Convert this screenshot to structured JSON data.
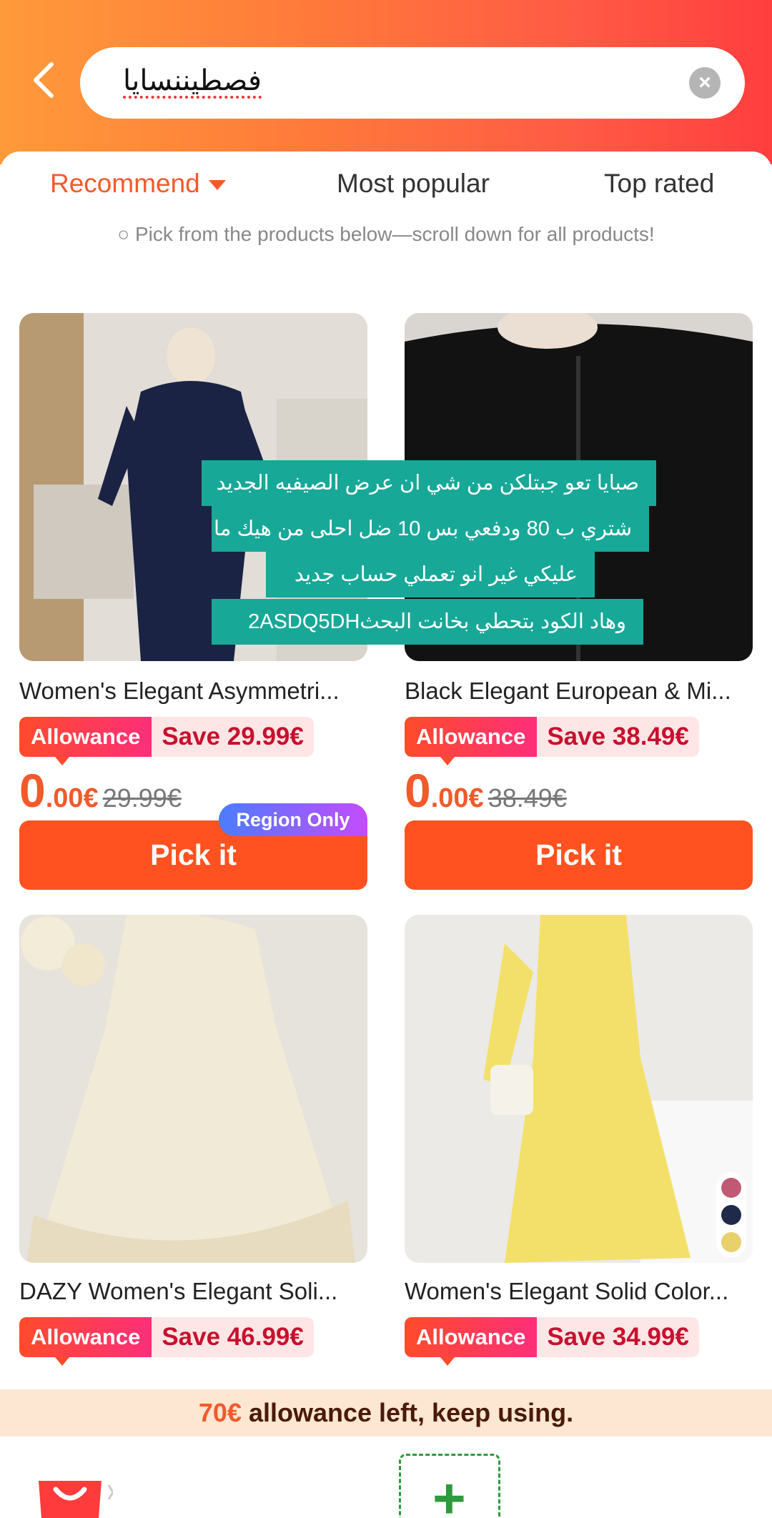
{
  "search": {
    "query": "فصطيننسايا"
  },
  "tabs": [
    {
      "label": "Recommend"
    },
    {
      "label": "Most popular"
    },
    {
      "label": "Top rated"
    }
  ],
  "hint": "○ Pick from the products below—scroll down for all products!",
  "products": [
    {
      "title": "Women's Elegant Asymmetri...",
      "allowance": "Allowance",
      "save": "Save 29.99€",
      "price_int": "0",
      "price_dec": ".00€",
      "old_price": "29.99€",
      "button": "Pick it",
      "tag": "Region Only"
    },
    {
      "title": "Black Elegant European & Mi...",
      "allowance": "Allowance",
      "save": "Save 38.49€",
      "price_int": "0",
      "price_dec": ".00€",
      "old_price": "38.49€",
      "button": "Pick it"
    },
    {
      "title": "DAZY Women's Elegant Soli...",
      "allowance": "Allowance",
      "save": "Save 46.99€"
    },
    {
      "title": "Women's Elegant Solid Color...",
      "allowance": "Allowance",
      "save": "Save 34.99€"
    }
  ],
  "overlay": {
    "lines": [
      "صبايا تعو جبتلكن من شي ان عرض الصيفيه الجديد",
      "شتري ب 80 ودفعي بس 10 ضل احلى من هيك ما",
      "عليكي غير انو تعملي حساب جديد",
      "وهاد الكود بتحطي بخانت البحث2ASDQ5DH"
    ]
  },
  "banner": {
    "amount": "70€",
    "text": " allowance left, keep using."
  },
  "colors": {
    "accent": "#f25a2b",
    "button": "#ff5220",
    "overlay": "#18a898"
  },
  "icons": [
    "back-arrow-icon",
    "clear-icon",
    "dropdown-caret-icon",
    "shopping-bag-icon",
    "plus-icon"
  ]
}
